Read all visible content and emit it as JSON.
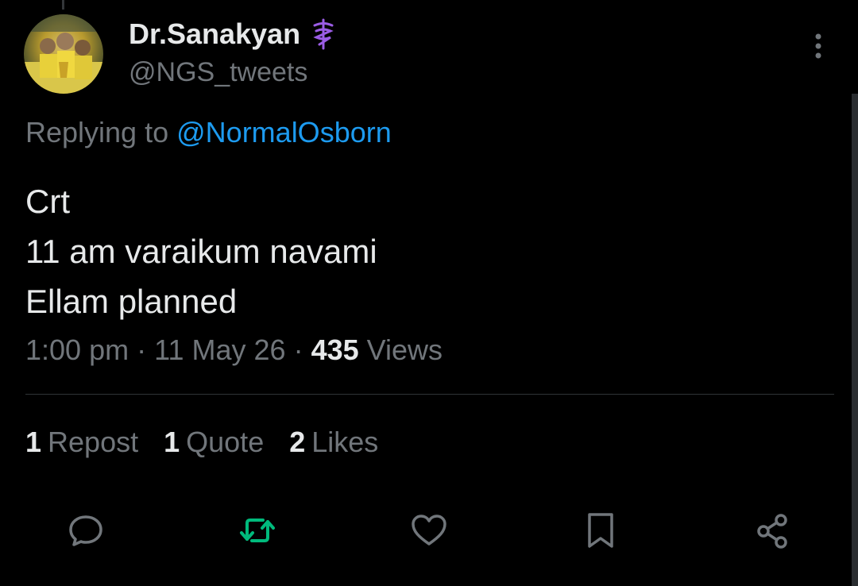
{
  "tweet": {
    "display_name": "Dr.Sanakyan",
    "handle": "@NGS_tweets",
    "replying_prefix": "Replying to",
    "replying_to": "@NormalOsborn",
    "lines": [
      "Crt",
      "11 am varaikum navami",
      "Ellam planned"
    ],
    "time": "1:00 pm",
    "date": "11 May 26",
    "views_count": "435",
    "views_label": "Views",
    "separator": "·"
  },
  "stats": {
    "reposts_count": "1",
    "reposts_label": "Repost",
    "quotes_count": "1",
    "quotes_label": "Quote",
    "likes_count": "2",
    "likes_label": "Likes"
  },
  "icons": {
    "badge": "medical-caduceus-icon",
    "more": "more-vertical-icon",
    "reply": "reply-icon",
    "repost": "repost-icon",
    "like": "heart-icon",
    "bookmark": "bookmark-icon",
    "share": "share-icon"
  },
  "colors": {
    "background": "#000000",
    "text_primary": "#e7e9ea",
    "text_secondary": "#71767b",
    "link": "#1d9bf0",
    "repost_active": "#00ba7c",
    "badge": "#9b5de5"
  }
}
